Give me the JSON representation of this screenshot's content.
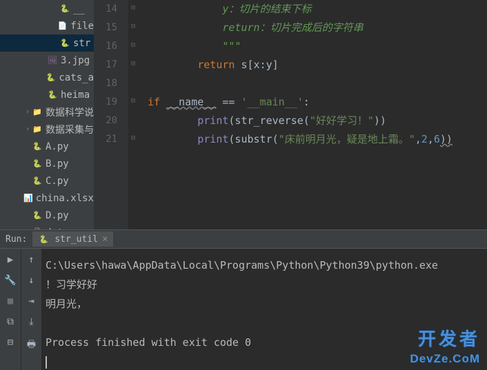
{
  "tree": {
    "items": [
      {
        "indent": "indent1",
        "icon": "py-icon",
        "glyph": "🐍",
        "label": "__"
      },
      {
        "indent": "indent1",
        "icon": "txt-icon",
        "glyph": "📄",
        "label": "file"
      },
      {
        "indent": "indent1",
        "icon": "py-icon",
        "glyph": "🐍",
        "label": "str",
        "selected": true
      },
      {
        "indent": "indent2",
        "icon": "img-icon",
        "glyph": "🖼",
        "label": "3.jpg"
      },
      {
        "indent": "indent2",
        "icon": "py-icon",
        "glyph": "🐍",
        "label": "cats_a"
      },
      {
        "indent": "indent2",
        "icon": "py-icon",
        "glyph": "🐍",
        "label": "heima"
      },
      {
        "indent": "indent3",
        "icon": "folder-icon",
        "glyph": "📁",
        "label": "数据科学说",
        "chevron": "›"
      },
      {
        "indent": "indent3",
        "icon": "folder-icon",
        "glyph": "📁",
        "label": "数据采集与",
        "chevron": "›"
      },
      {
        "indent": "indent3",
        "icon": "py-icon",
        "glyph": "🐍",
        "label": "A.py"
      },
      {
        "indent": "indent3",
        "icon": "py-icon",
        "glyph": "🐍",
        "label": "B.py"
      },
      {
        "indent": "indent3",
        "icon": "py-icon",
        "glyph": "🐍",
        "label": "C.py"
      },
      {
        "indent": "indent3",
        "icon": "xls-icon",
        "glyph": "📊",
        "label": "china.xlsx"
      },
      {
        "indent": "indent3",
        "icon": "py-icon",
        "glyph": "🐍",
        "label": "D.py"
      },
      {
        "indent": "indent3",
        "icon": "csv-icon",
        "glyph": "🗎",
        "label": "data.csv"
      }
    ]
  },
  "code": {
    "line_start": 14,
    "line_end": 21,
    "l14": "            y：切片的结束下标",
    "l15_a": "            ",
    "l15_ret": "return",
    "l15_b": "：切片完成后的字符串",
    "l16": "            \"\"\"",
    "l17_a": "        ",
    "l17_ret": "return ",
    "l17_b": "s[x:y]",
    "l19_if": "if ",
    "l19_name": "__name__",
    "l19_eq": " == ",
    "l19_main": "'__main__'",
    "l19_colon": ":",
    "l20_a": "        ",
    "l20_print": "print",
    "l20_b": "(str_reverse(",
    "l20_str": "\"好好学习！\"",
    "l20_c": "))",
    "l21_a": "        ",
    "l21_print": "print",
    "l21_b": "(substr(",
    "l21_str": "\"床前明月光，疑是地上霜。\"",
    "l21_c": ",",
    "l21_n1": "2",
    "l21_d": ",",
    "l21_n2": "6",
    "l21_e": "))"
  },
  "run": {
    "title": "Run:",
    "tab": "str_util",
    "out1": "C:\\Users\\hawa\\AppData\\Local\\Programs\\Python\\Python39\\python.exe",
    "out2": "！习学好好",
    "out3": "明月光，",
    "out4": "Process finished with exit code 0"
  },
  "watermark": {
    "text": "开发者",
    "sub": "DevZe.CoM"
  }
}
